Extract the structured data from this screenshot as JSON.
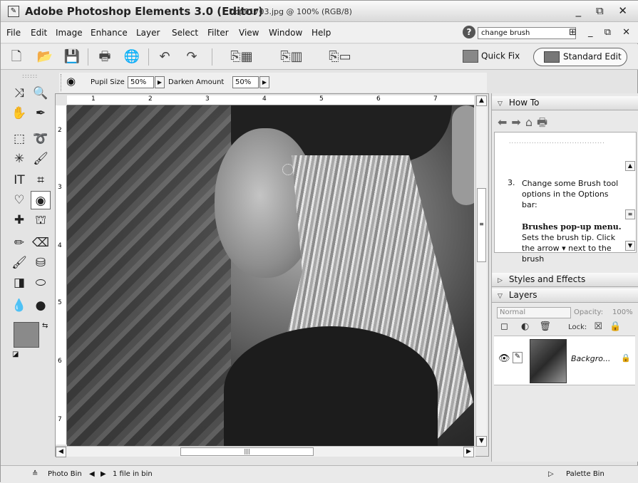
{
  "window": {
    "title": "Adobe Photoshop Elements 3.0 (Editor)",
    "document": "Dcp01703.jpg @ 100% (RGB/8)",
    "controls": "_ ⧉ ✕"
  },
  "menu": {
    "items": [
      "File",
      "Edit",
      "Image",
      "Enhance",
      "Layer",
      "Select",
      "Filter",
      "View",
      "Window",
      "Help"
    ],
    "search_value": "change brush",
    "right_controls": "⊞ _ ⧉ ✕"
  },
  "toolbar": {
    "quick_fix_label": "Quick Fix",
    "standard_edit_label": "Standard Edit"
  },
  "options_bar": {
    "pupil_size_label": "Pupil Size",
    "pupil_size_value": "50%",
    "darken_amount_label": "Darken Amount",
    "darken_amount_value": "50%"
  },
  "rulers": {
    "top": [
      "1",
      "2",
      "3",
      "4",
      "5",
      "6",
      "7"
    ],
    "left": [
      "2",
      "3",
      "4",
      "5",
      "6",
      "7"
    ]
  },
  "palette": {
    "howto_title": "How To",
    "step_number": "3.",
    "step_text": "Change some Brush tool options in the Options bar:",
    "step_bold": "Brushes pop-up menu.",
    "step_desc": " Sets the brush tip. Click the arrow ▾ next to the brush",
    "styles_title": "Styles and Effects",
    "layers_title": "Layers",
    "blend_mode": "Normal",
    "opacity_label": "Opacity:",
    "opacity_value": "100%",
    "lock_label": "Lock:",
    "layer_name": "Backgro..."
  },
  "statusbar": {
    "photo_bin": "Photo Bin",
    "files_in_bin": "1 file in bin",
    "palette_bin": "Palette Bin"
  }
}
